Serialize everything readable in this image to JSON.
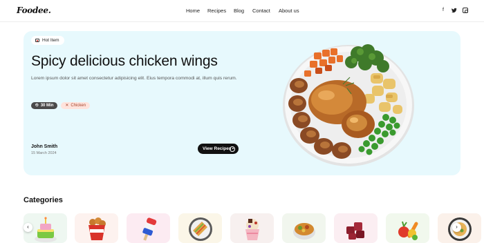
{
  "brand": {
    "logo_text": "Foodee."
  },
  "nav": {
    "items": [
      "Home",
      "Recipes",
      "Blog",
      "Contact",
      "About us"
    ]
  },
  "social": [
    "facebook-icon",
    "twitter-icon",
    "instagram-icon"
  ],
  "hero": {
    "badge": "Hot Item",
    "title": "Spicy delicious chicken wings",
    "description": "Lorem ipsum dolor sit amet consectetur adipisicing elit. Eius tempora commodi at, illum quis rerum.",
    "time_tag": "30 Min",
    "category_tag": "Chicken",
    "author_name": "John Smith",
    "author_date": "15 March 2024",
    "cta_label": "View Recipes",
    "background": "#e7f9fd"
  },
  "categories": {
    "title": "Categories",
    "items": [
      {
        "icon": "cake-icon",
        "bg": "#eef7f1"
      },
      {
        "icon": "fried-chicken-bucket-icon",
        "bg": "#fdf2ef"
      },
      {
        "icon": "ice-pop-icon",
        "bg": "#fcebf2"
      },
      {
        "icon": "sandwich-plate-icon",
        "bg": "#fbf6e8"
      },
      {
        "icon": "ice-cream-cup-icon",
        "bg": "#f7f0ef"
      },
      {
        "icon": "noodle-bowl-icon",
        "bg": "#f1f6ee"
      },
      {
        "icon": "meat-cubes-icon",
        "bg": "#fbeef2"
      },
      {
        "icon": "vegetables-icon",
        "bg": "#f1f8ed"
      },
      {
        "icon": "rice-bowl-icon",
        "bg": "#fbf1ea"
      }
    ]
  }
}
